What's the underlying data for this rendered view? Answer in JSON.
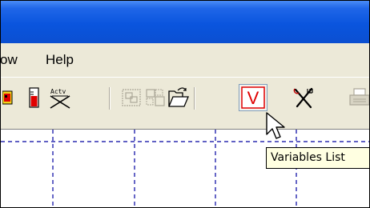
{
  "menubar": {
    "items": [
      {
        "label": "ow"
      },
      {
        "label": "Help"
      }
    ]
  },
  "toolbar": {
    "buttons": [
      {
        "icon": "red-yellow-block-icon",
        "enabled": true
      },
      {
        "icon": "thermometer-gauge-icon",
        "enabled": true
      },
      {
        "icon": "activex-control-icon",
        "label": "Actv",
        "enabled": true
      },
      {
        "icon": "group-objects-icon",
        "enabled": false
      },
      {
        "icon": "ungroup-objects-icon",
        "enabled": false
      },
      {
        "icon": "open-folder-icon",
        "enabled": true
      },
      {
        "icon": "variables-list-icon",
        "label": "V",
        "enabled": true,
        "pressed": true
      },
      {
        "icon": "tools-icon",
        "enabled": true
      },
      {
        "icon": "print-icon",
        "enabled": false
      }
    ]
  },
  "tooltip": {
    "text": "Variables List"
  },
  "colors": {
    "titlebar": "#0a55de",
    "chrome": "#ece9d8",
    "tooltip_bg": "#ffffe1",
    "grid_line": "#0000a0",
    "accent_red": "#e00000"
  }
}
